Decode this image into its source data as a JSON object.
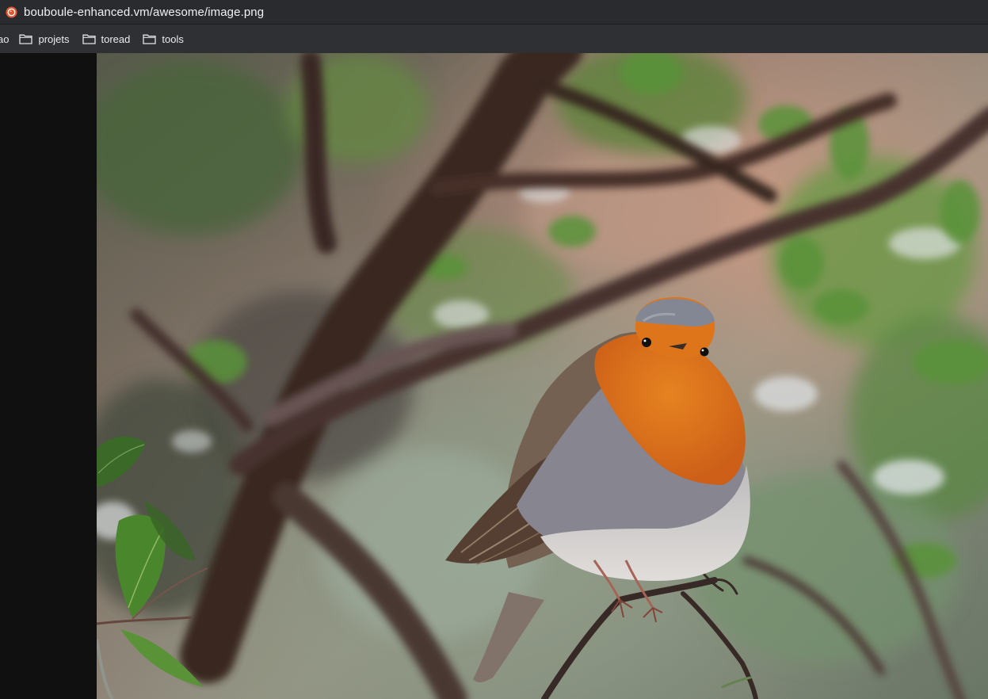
{
  "address_bar": {
    "url": "bouboule-enhanced.vm/awesome/image.png",
    "site_icon": "duckduckgo-icon"
  },
  "bookmarks": {
    "partial_label": "ao",
    "items": [
      {
        "label": "projets",
        "icon": "folder-icon"
      },
      {
        "label": "toread",
        "icon": "folder-icon"
      },
      {
        "label": "tools",
        "icon": "folder-icon"
      }
    ]
  },
  "viewer": {
    "image_subject": "robin-photo",
    "colors": {
      "background": "#101011",
      "breast": "#e8761c",
      "bokeh_green": "#6f9d4c",
      "bokeh_peach": "#c99b84"
    }
  }
}
